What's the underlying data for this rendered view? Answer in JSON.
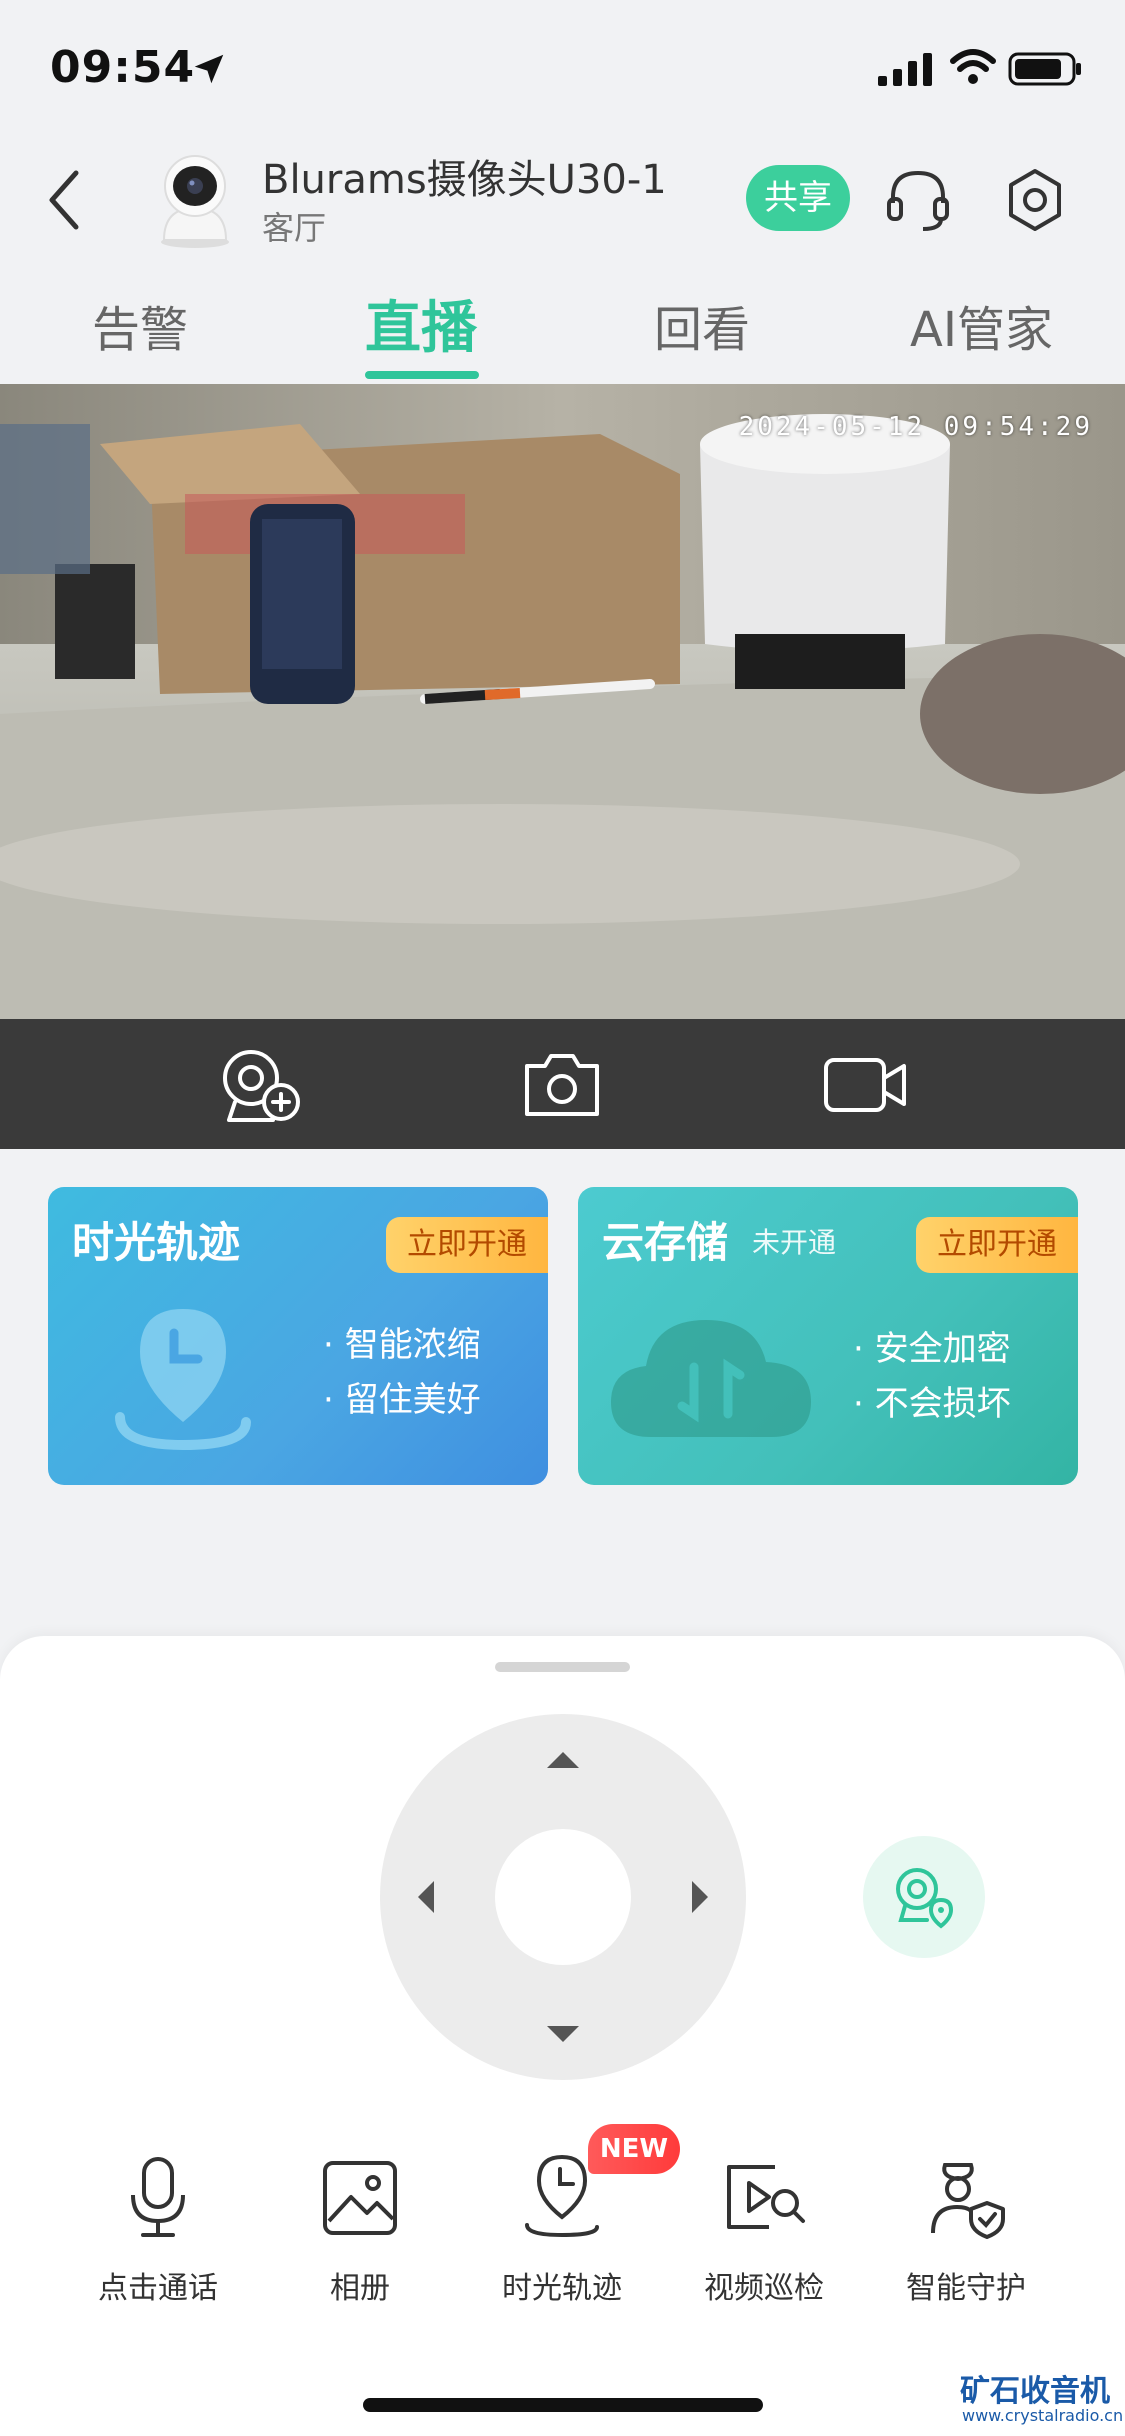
{
  "status_bar": {
    "time": "09:54"
  },
  "header": {
    "device_name": "Blurams摄像头U30-1",
    "room": "客厅",
    "share_label": "共享"
  },
  "tabs": [
    {
      "label": "告警",
      "active": false
    },
    {
      "label": "直播",
      "active": true
    },
    {
      "label": "回看",
      "active": false
    },
    {
      "label": "AI管家",
      "active": false
    }
  ],
  "video": {
    "timestamp": "2024-05-12 09:54:29"
  },
  "cards": [
    {
      "title": "时光轨迹",
      "subtitle": "",
      "badge": "立即开通",
      "bullets": [
        "智能浓缩",
        "留住美好"
      ]
    },
    {
      "title": "云存储",
      "subtitle": "未开通",
      "badge": "立即开通",
      "bullets": [
        "安全加密",
        "不会损坏"
      ]
    }
  ],
  "tools": [
    {
      "label": "点击通话",
      "icon": "microphone-icon"
    },
    {
      "label": "相册",
      "icon": "photo-album-icon"
    },
    {
      "label": "时光轨迹",
      "icon": "time-track-icon"
    },
    {
      "label": "视频巡检",
      "icon": "video-inspection-icon"
    },
    {
      "label": "智能守护",
      "icon": "smart-guard-icon"
    }
  ],
  "new_badge": "NEW",
  "watermark": {
    "main": "矿石收音机",
    "url": "www.crystalradio.cn"
  },
  "colors": {
    "accent": "#2fc59a",
    "share": "#3ccf9c",
    "badge_red": "#ff3b3b",
    "video_bar": "#3a3a3a"
  }
}
